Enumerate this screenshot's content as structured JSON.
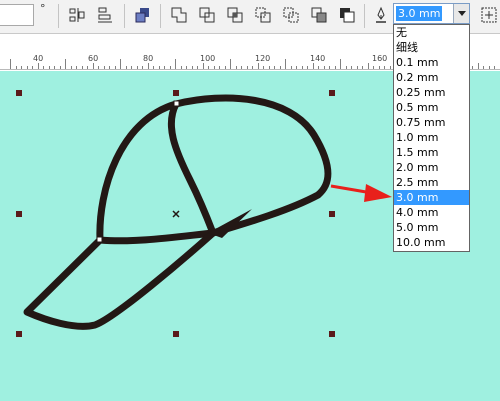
{
  "toolbar": {
    "degree_symbol": "°",
    "icons": [
      "align-distribute-icon",
      "align-icon",
      "order-icon",
      "weld-icon",
      "trim-icon",
      "intersect-icon",
      "simplify-icon",
      "front-minus-back-icon",
      "back-minus-front-icon",
      "create-boundary-icon",
      "pen-outline-icon",
      "options-icon"
    ],
    "outline_width_value": "3.0 mm"
  },
  "ruler": {
    "labels": [
      "40",
      "60",
      "80",
      "100",
      "120",
      "140",
      "160"
    ]
  },
  "outline_dropdown": {
    "options": [
      "无",
      "细线",
      "0.1 mm",
      "0.2 mm",
      "0.25 mm",
      "0.5 mm",
      "0.75 mm",
      "1.0 mm",
      "1.5 mm",
      "2.0 mm",
      "2.5 mm",
      "3.0 mm",
      "4.0 mm",
      "5.0 mm",
      "10.0 mm"
    ],
    "selected": "3.0 mm"
  },
  "colors": {
    "canvas_background": "#9ff0e0",
    "shape_outline": "#231815",
    "selection_handle": "#5a1a1a",
    "arrow": "#e8201b",
    "highlight": "#3399ff"
  }
}
